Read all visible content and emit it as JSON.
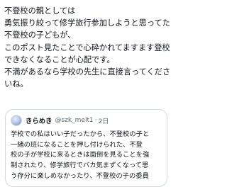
{
  "post": {
    "text_lines": [
      "不登校の親としては",
      "勇気振り絞って修学旅行参加しようと思ってた",
      "不登校の子どもが、",
      "このポスト見たことで心砕かれてますます登校",
      "できなくなることが心配です。",
      "不満があるなら学校の先生に直接言ってくださ",
      "いね。"
    ]
  },
  "quote": {
    "display_name": "きらめき",
    "handle": "@szk_melt1",
    "separator": "·",
    "date": "2日",
    "text_lines": [
      "学校での私はいい子だったから、不登校の子と",
      "一緒の班になることを押し付けられた、不登",
      "校の子が学校に来るときは面倒を見ることを強",
      "制されたり、修学旅行でバカ気まずくなって思",
      "う存分に楽しめなかったり、不登校の子の委員"
    ]
  }
}
